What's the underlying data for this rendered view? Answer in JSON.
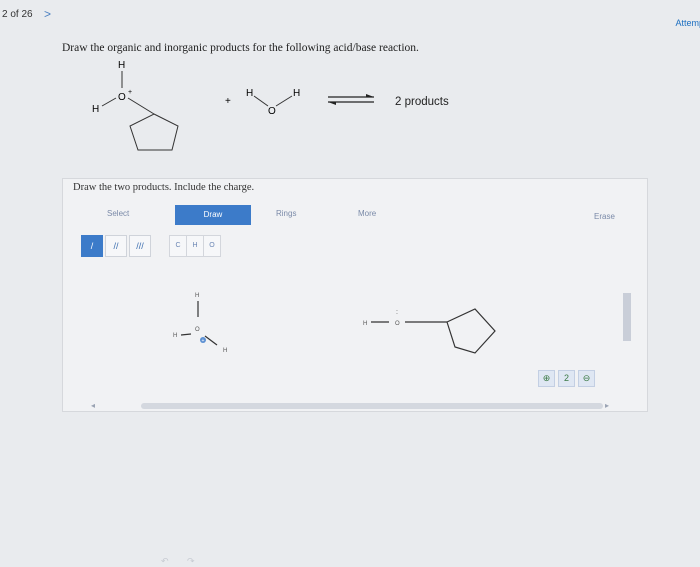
{
  "header": {
    "counter": "2 of 26",
    "next_glyph": ">",
    "attempt": "Attemp"
  },
  "question": {
    "prompt": "Draw the organic and inorganic products for the following acid/base reaction.",
    "reactant1": {
      "h_top": "H",
      "oxygen": "O",
      "charge": "+",
      "h_left": "H"
    },
    "plus": "+",
    "reactant2": {
      "h_left": "H",
      "oxygen": "O",
      "h_right": "H"
    },
    "products_label": "2 products"
  },
  "panel": {
    "heading": "Draw the two products. Include the charge.",
    "toolbar": {
      "select": "Select",
      "draw": "Draw",
      "rings": "Rings",
      "more": "More",
      "erase": "Erase"
    },
    "bonds": [
      "/",
      "//",
      "///"
    ],
    "atoms": [
      "C",
      "H",
      "O"
    ],
    "drawn": {
      "hydronium": {
        "h_top": "H",
        "h_left": "H",
        "oxygen": "O",
        "charge": "+",
        "h_right": "H"
      },
      "alcohol": {
        "h": "H",
        "oxygen": "O",
        "lone_pair": ":"
      }
    },
    "undo_glyph": "↶",
    "redo_glyph": "↷",
    "zoom_in": "⊕",
    "zoom_reset": "2",
    "zoom_out": "⊖",
    "scroll_left": "◂",
    "scroll_right": "▸"
  },
  "colors": {
    "accent": "#3c7bc9",
    "link": "#1d6fc0"
  }
}
